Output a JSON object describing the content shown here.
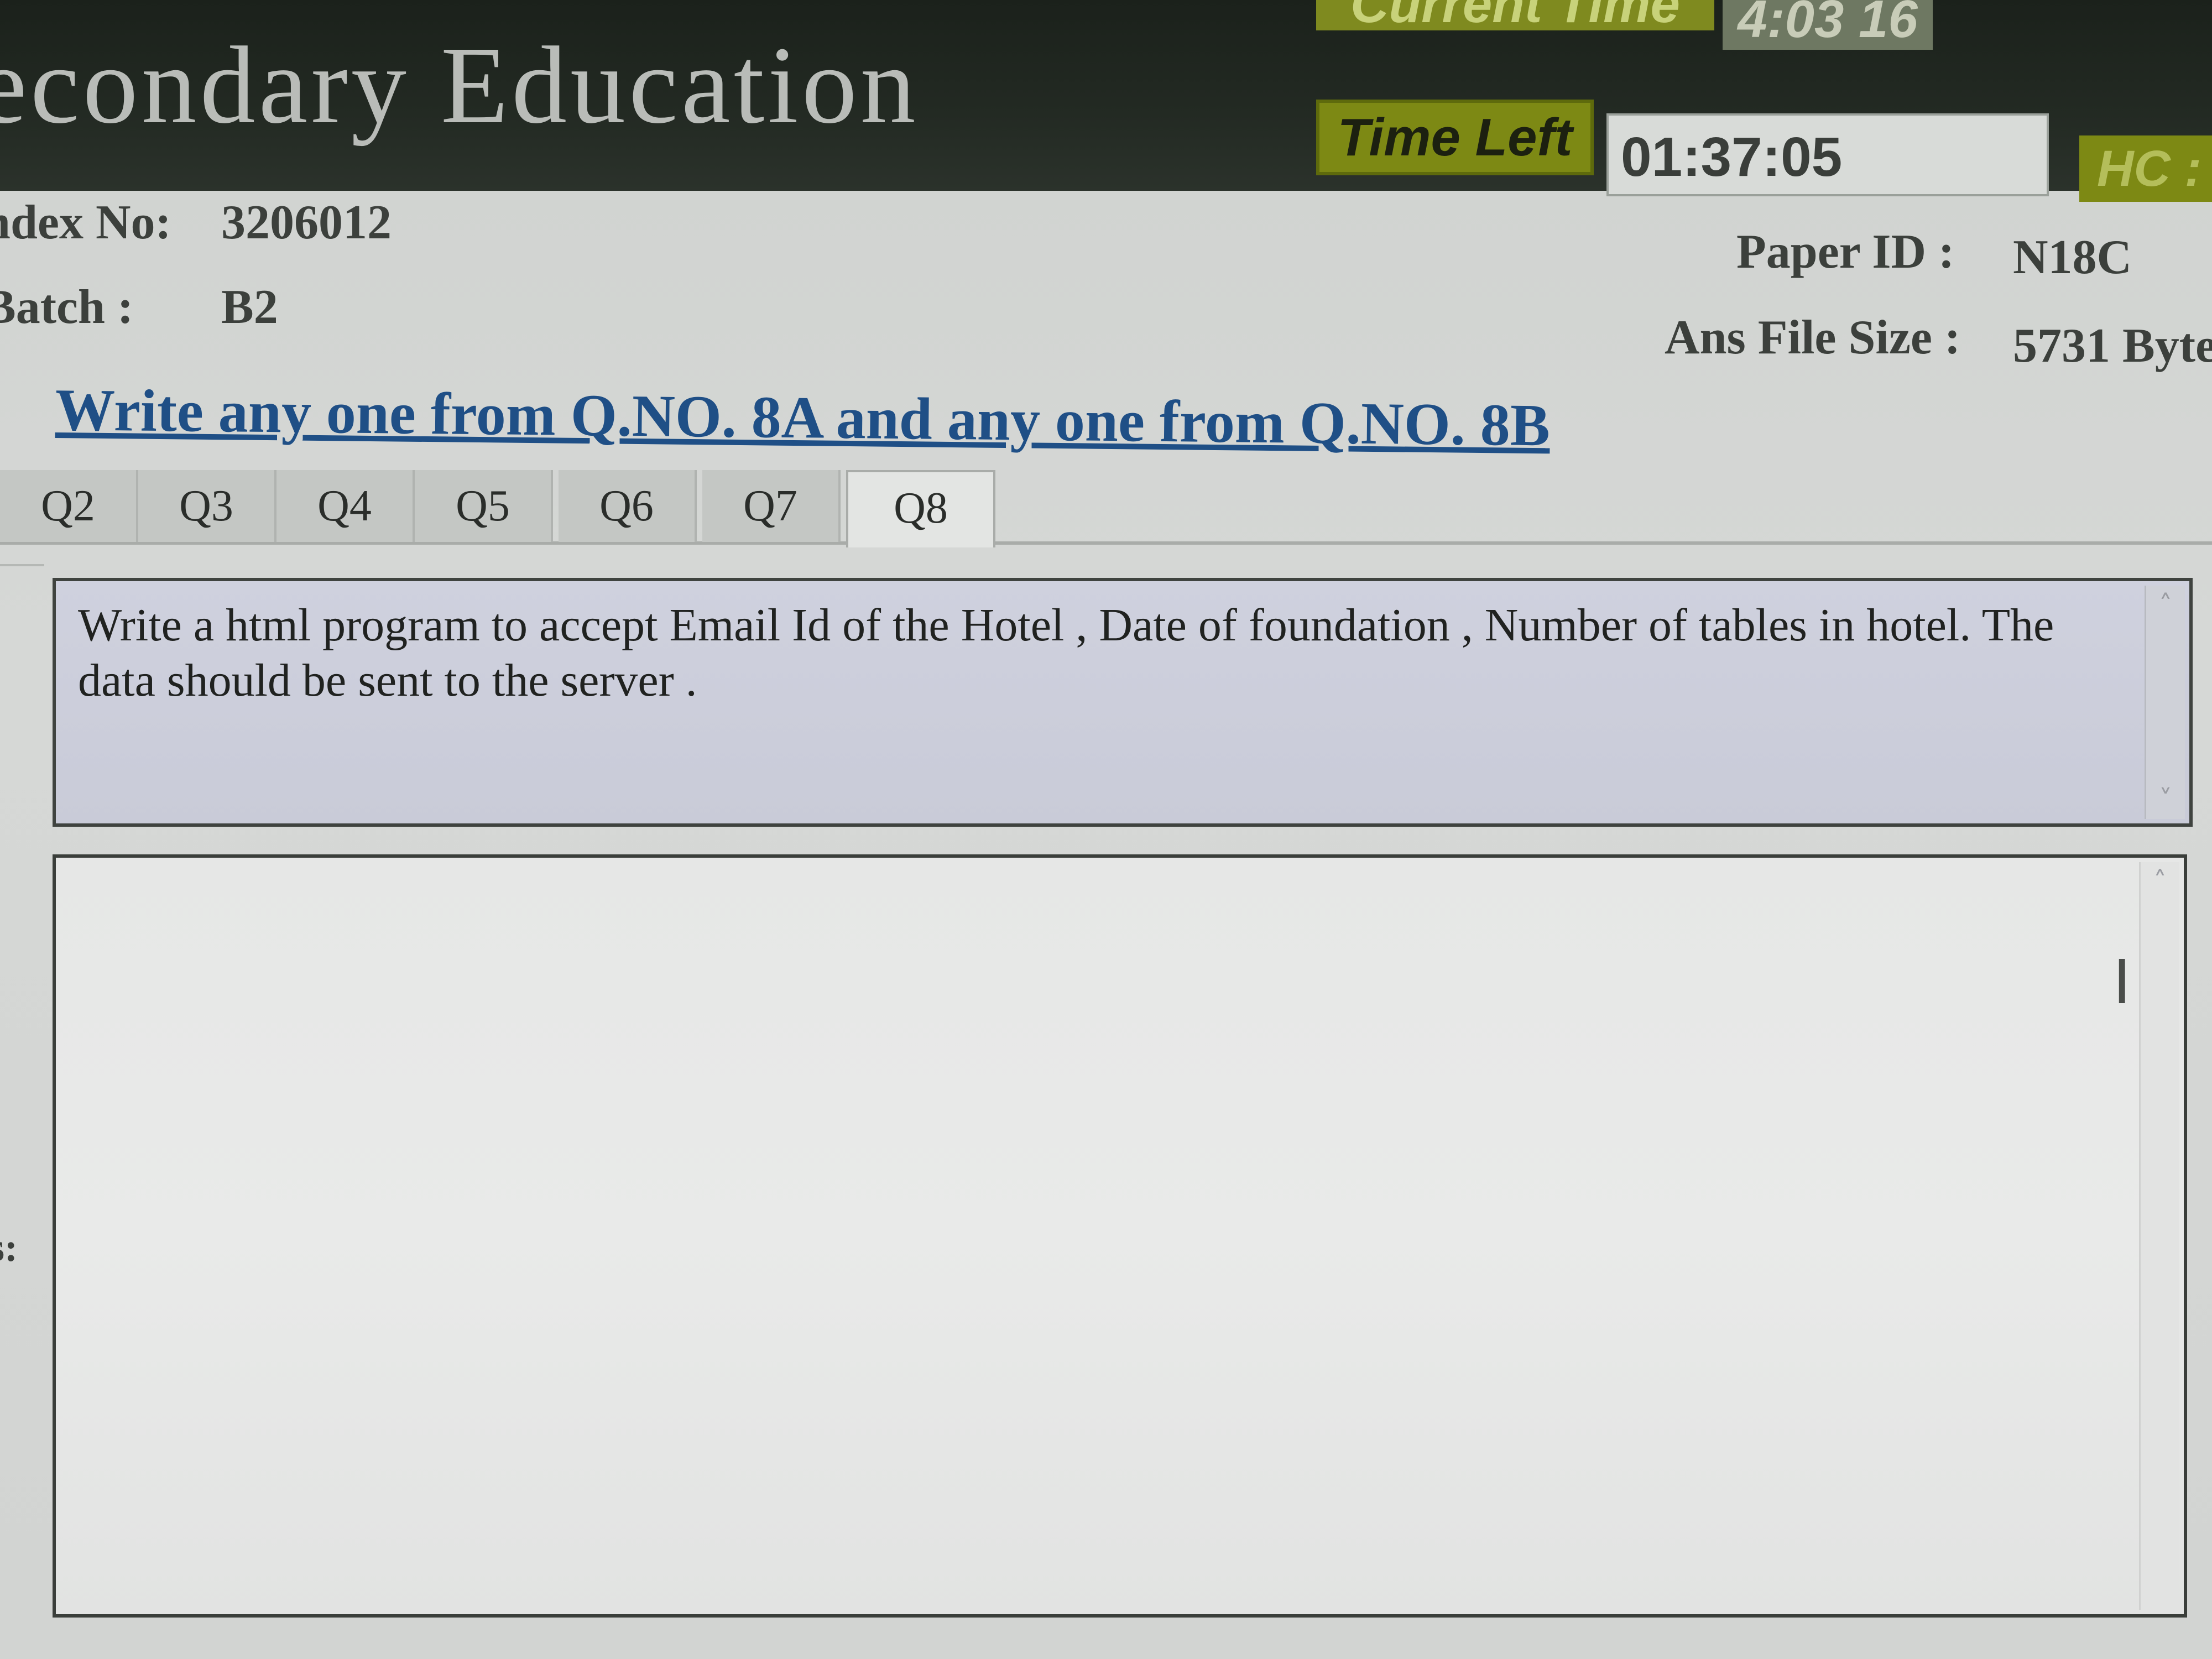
{
  "header": {
    "title": "econdary Education",
    "current_time_label": "Current Time",
    "current_time_value": "4:03 16",
    "time_left_label": "Time Left",
    "time_left_value": "01:37:05",
    "hc_label": "HC :"
  },
  "candidate": {
    "index_label": "ndex No:",
    "index_value": "3206012",
    "batch_label": "Batch :",
    "batch_value": "B2",
    "paper_id_label": "Paper ID :",
    "paper_id_value": "N18C",
    "ans_file_size_label": "Ans File Size :",
    "ans_file_size_value": "5731 Byte"
  },
  "instruction": "Write any one from Q.NO. 8A and any one from Q.NO. 8B",
  "tabs": [
    {
      "label": "Q2"
    },
    {
      "label": "Q3"
    },
    {
      "label": "Q4"
    },
    {
      "label": "Q5"
    },
    {
      "label": "Q6"
    },
    {
      "label": "Q7"
    },
    {
      "label": "Q8"
    }
  ],
  "active_tab": "Q8",
  "question": {
    "text": "Write a html program to accept Email Id of the Hotel , Date of foundation , Number of tables in hotel. The data  should be sent to the server ."
  },
  "answer": {
    "value": ""
  },
  "side_marker": "s:",
  "icons": {
    "scroll_up": "chevron-up-icon",
    "scroll_down": "chevron-down-icon",
    "text_cursor": "i-beam-cursor-icon"
  },
  "colors": {
    "header_bg": "#1f251f",
    "label_green": "#7d8914",
    "instruction_blue": "#1f4f86"
  }
}
